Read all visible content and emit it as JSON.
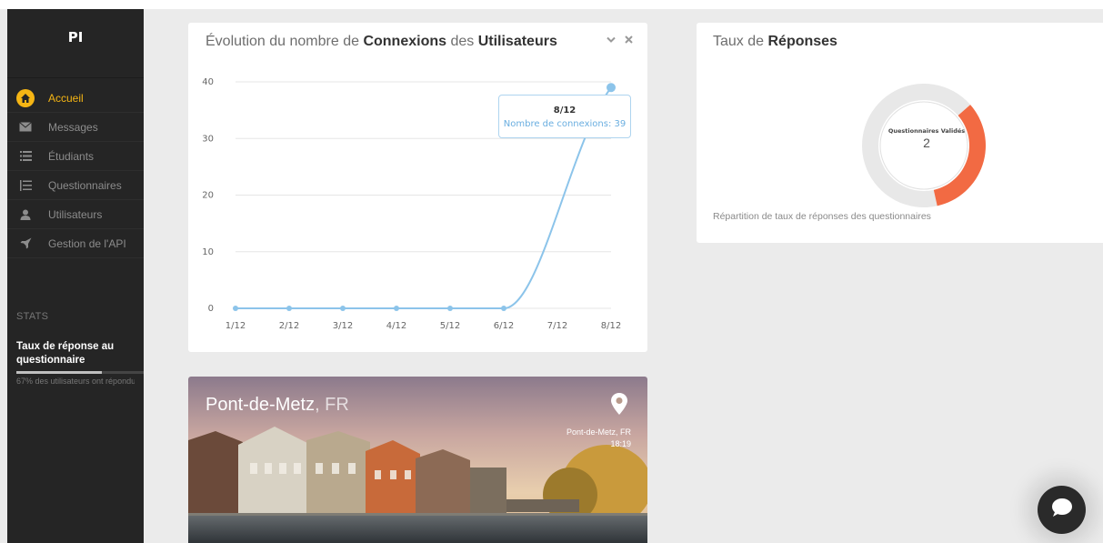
{
  "brand": "PI",
  "nav": [
    {
      "label": "Accueil",
      "icon": "home-icon",
      "active": true
    },
    {
      "label": "Messages",
      "icon": "envelope-icon",
      "active": false
    },
    {
      "label": "Étudiants",
      "icon": "list-icon",
      "active": false
    },
    {
      "label": "Questionnaires",
      "icon": "checklist-icon",
      "active": false
    },
    {
      "label": "Utilisateurs",
      "icon": "user-icon",
      "active": false
    },
    {
      "label": "Gestion de l'API",
      "icon": "rocket-icon",
      "active": false
    }
  ],
  "stats": {
    "title": "STATS",
    "label": "Taux de réponse au questionnaire",
    "progress_pct": 67,
    "note": "67% des utilisateurs ont répondu"
  },
  "chart_card": {
    "title_part1": "Évolution du nombre de ",
    "title_bold1": "Connexions",
    "title_part2": " des ",
    "title_bold2": "Utilisateurs",
    "tooltip_date": "8/12",
    "tooltip_value": "Nombre de connexions: 39"
  },
  "chart_data": {
    "type": "line",
    "categories": [
      "1/12",
      "2/12",
      "3/12",
      "4/12",
      "5/12",
      "6/12",
      "7/12",
      "8/12"
    ],
    "series": [
      {
        "name": "Nombre de connexions",
        "values": [
          0,
          0,
          0,
          0,
          0,
          0,
          null,
          39
        ],
        "color": "#8cc4ea"
      }
    ],
    "yticks": [
      0,
      10,
      20,
      30,
      40
    ],
    "ylim": [
      0,
      40
    ],
    "grid": true,
    "title": "Évolution du nombre de Connexions des Utilisateurs",
    "xlabel": "",
    "ylabel": ""
  },
  "responses_card": {
    "title_part1": "Taux de ",
    "title_bold": "Réponses",
    "center_label": "Questionnaires Validés",
    "center_value": "2",
    "note": "Répartition de taux de réponses des questionnaires",
    "donut_fraction": 0.33,
    "colors": {
      "done": "#f26a43",
      "rest": "#e8e8e8"
    }
  },
  "weather": {
    "city": "Pont-de-Metz",
    "country": ", FR",
    "meta_place": "Pont-de-Metz, FR",
    "meta_time": "18:19"
  },
  "colors": {
    "accent": "#f5b514",
    "line": "#8cc4ea"
  }
}
